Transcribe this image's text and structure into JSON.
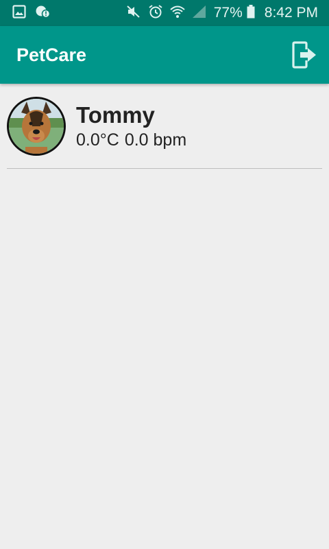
{
  "status_bar": {
    "battery_percent": "77%",
    "time": "8:42 PM",
    "left_icons": [
      "image-icon",
      "chat-alert-icon"
    ],
    "right_icons": [
      "mute-icon",
      "alarm-icon",
      "wifi-icon",
      "signal-icon",
      "battery-icon"
    ]
  },
  "app_bar": {
    "title": "PetCare",
    "logout_icon": "logout-icon"
  },
  "pets": [
    {
      "name": "Tommy",
      "temperature": "0.0°C",
      "heart_rate": "0.0 bpm"
    }
  ],
  "colors": {
    "status_bar": "#00786b",
    "primary": "#00968a",
    "background": "#eeeeee"
  }
}
